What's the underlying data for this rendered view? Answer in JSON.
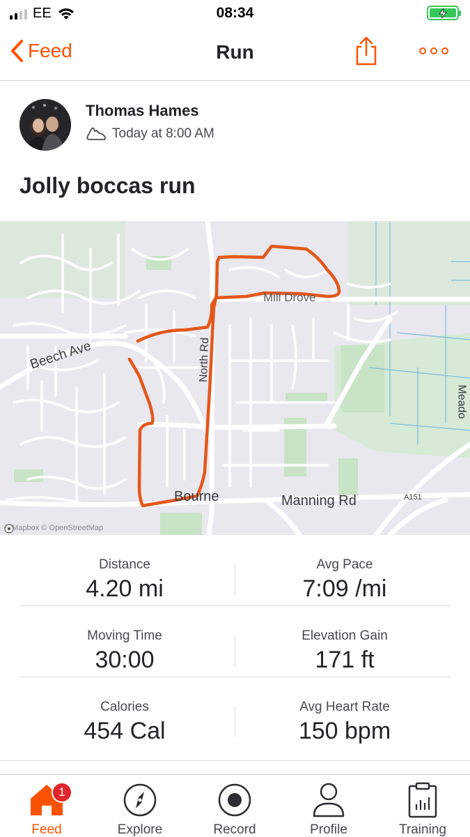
{
  "status_bar": {
    "carrier": "EE",
    "time": "08:34",
    "signal_bars": 4,
    "signal_active": 2,
    "battery_level": 1.0,
    "battery_charging": true
  },
  "nav": {
    "back_label": "Feed",
    "title": "Run"
  },
  "activity": {
    "athlete_name": "Thomas Hames",
    "timestamp": "Today at 8:00 AM",
    "title": "Jolly boccas run",
    "sport_icon": "shoe-icon"
  },
  "map": {
    "labels": {
      "beech_ave": "Beech Ave",
      "north_rd": "North Rd",
      "mill_drove": "Mill Drove",
      "bourne": "Bourne",
      "manning_rd": "Manning Rd",
      "a151": "A151",
      "meadow": "Meado"
    },
    "attribution": "© Mapbox © OpenStreetMap",
    "route_color": "#e4571a"
  },
  "stats": [
    {
      "left": {
        "label": "Distance",
        "value": "4.20 mi"
      },
      "right": {
        "label": "Avg Pace",
        "value": "7:09 /mi"
      }
    },
    {
      "left": {
        "label": "Moving Time",
        "value": "30:00"
      },
      "right": {
        "label": "Elevation Gain",
        "value": "171 ft"
      }
    },
    {
      "left": {
        "label": "Calories",
        "value": "454 Cal"
      },
      "right": {
        "label": "Avg Heart Rate",
        "value": "150 bpm"
      }
    }
  ],
  "tabs": [
    {
      "label": "Feed",
      "icon": "home-icon",
      "active": true,
      "badge": "1"
    },
    {
      "label": "Explore",
      "icon": "compass-icon",
      "active": false
    },
    {
      "label": "Record",
      "icon": "record-icon",
      "active": false
    },
    {
      "label": "Profile",
      "icon": "person-icon",
      "active": false
    },
    {
      "label": "Training",
      "icon": "clipboard-chart-icon",
      "active": false
    }
  ],
  "colors": {
    "accent": "#fc5200",
    "badge": "#e0262b",
    "battery": "#34c759"
  }
}
